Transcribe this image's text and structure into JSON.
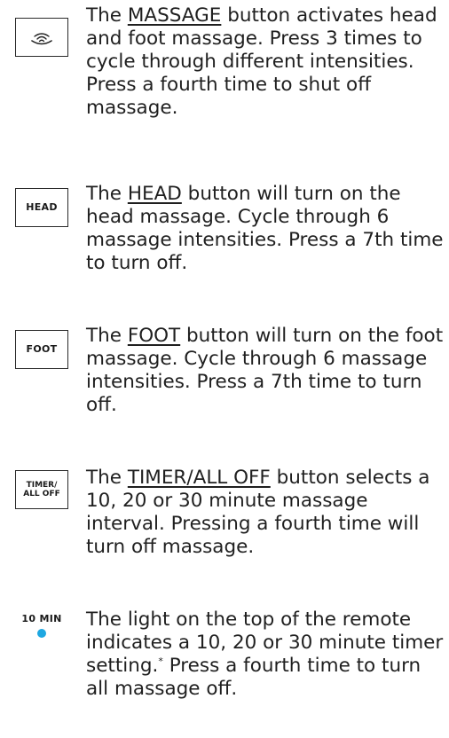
{
  "entries": [
    {
      "icon": "massage-wave-icon",
      "pre": "The ",
      "keyword": "MASSAGE",
      "post": " button activates head and foot massage. Press 3 times to cycle through different intensities. Press a fourth time to shut off massage."
    },
    {
      "icon_text": "HEAD",
      "pre": "The ",
      "keyword": "HEAD",
      "post": " button will turn on the head massage. Cycle through 6 massage intensities. Press a 7th time to turn off."
    },
    {
      "icon_text": "FOOT",
      "pre": "The ",
      "keyword": "FOOT",
      "post": " button will turn on the foot massage. Cycle through 6 massage intensities. Press a 7th time to turn off."
    },
    {
      "icon_text_line1": "TIMER/",
      "icon_text_line2": "ALL OFF",
      "pre": "The ",
      "keyword": "TIMER/ALL OFF",
      "post": " button selects a 10, 20 or 30 minute massage interval. Pressing a fourth time will turn off massage."
    },
    {
      "led_label": "10 MIN",
      "led_color": "#1ea7e1",
      "pre": "The light on the top of the remote indicates a 10, 20 or 30 minute timer setting.",
      "footnote": "*",
      "post": " Press a fourth time to turn all massage off."
    }
  ]
}
